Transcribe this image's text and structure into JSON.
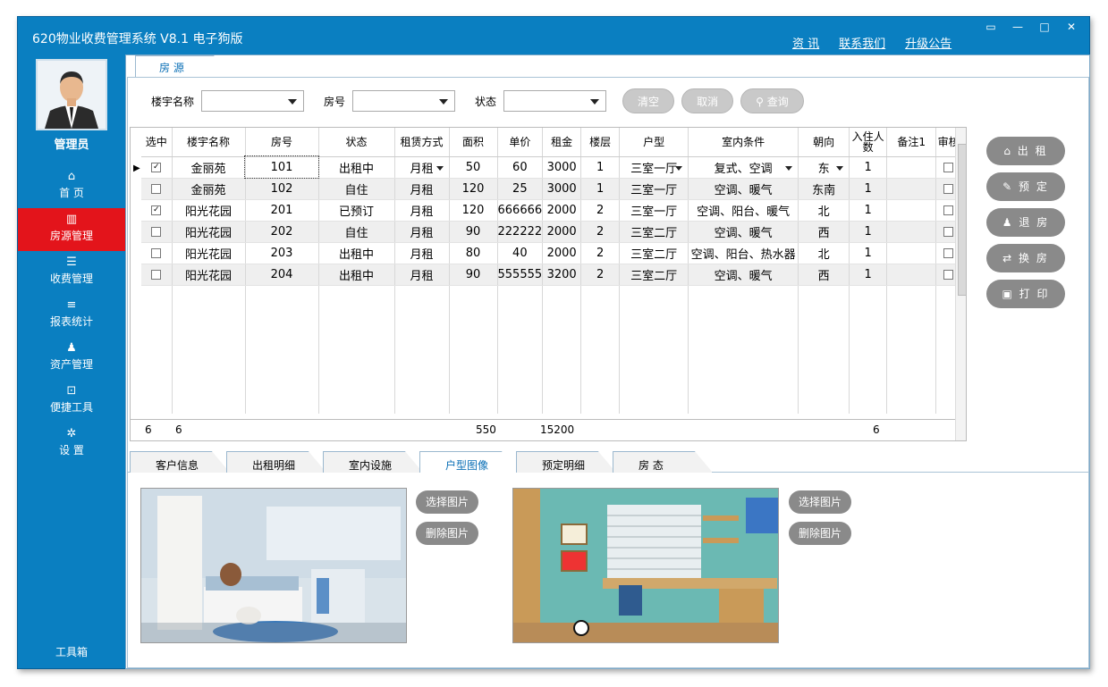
{
  "window": {
    "title": "620物业收费管理系统 V8.1  电子狗版",
    "links": [
      "资 讯",
      "联系我们",
      "升级公告"
    ],
    "controls": [
      "▭",
      "—",
      "□",
      "✕"
    ]
  },
  "sidebar": {
    "user": "管理员",
    "items": [
      {
        "icon": "home-icon",
        "label": "首 页",
        "glyph": "⌂"
      },
      {
        "icon": "building-icon",
        "label": "房源管理",
        "glyph": "▥",
        "active": true
      },
      {
        "icon": "list-icon",
        "label": "收费管理",
        "glyph": "☰"
      },
      {
        "icon": "report-icon",
        "label": "报表统计",
        "glyph": "≡"
      },
      {
        "icon": "asset-icon",
        "label": "资产管理",
        "glyph": "♟"
      },
      {
        "icon": "tool-icon",
        "label": "便捷工具",
        "glyph": "⊡"
      },
      {
        "icon": "gear-icon",
        "label": "设 置",
        "glyph": "✲"
      }
    ],
    "toolbox": "工具箱"
  },
  "top_tab": "房 源",
  "filters": {
    "building_label": "楼宇名称",
    "room_label": "房号",
    "status_label": "状态",
    "clear": "清空",
    "cancel": "取消",
    "query": "查询"
  },
  "grid": {
    "headers": [
      "选中",
      "楼宇名称",
      "房号",
      "状态",
      "租赁方式",
      "面积",
      "单价",
      "租金",
      "楼层",
      "户型",
      "室内条件",
      "朝向",
      "入住人数",
      "备注1",
      "审核"
    ],
    "rows": [
      {
        "checked": true,
        "building": "金丽苑",
        "room": "101",
        "status": "出租中",
        "lease": "月租",
        "area": "50",
        "price": "60",
        "rent": "3000",
        "floor": "1",
        "layout": "三室一厅",
        "cond": "复式、空调",
        "facing": "东",
        "people": "1",
        "note": "",
        "audit": false
      },
      {
        "checked": false,
        "building": "金丽苑",
        "room": "102",
        "status": "自住",
        "lease": "月租",
        "area": "120",
        "price": "25",
        "rent": "3000",
        "floor": "1",
        "layout": "三室一厅",
        "cond": "空调、暖气",
        "facing": "东南",
        "people": "1",
        "note": "",
        "audit": false
      },
      {
        "checked": true,
        "building": "阳光花园",
        "room": "201",
        "status": "已预订",
        "lease": "月租",
        "area": "120",
        "price": "666666",
        "rent": "2000",
        "floor": "2",
        "layout": "三室一厅",
        "cond": "空调、阳台、暖气",
        "facing": "北",
        "people": "1",
        "note": "",
        "audit": false
      },
      {
        "checked": false,
        "building": "阳光花园",
        "room": "202",
        "status": "自住",
        "lease": "月租",
        "area": "90",
        "price": "222222",
        "rent": "2000",
        "floor": "2",
        "layout": "三室二厅",
        "cond": "空调、暖气",
        "facing": "西",
        "people": "1",
        "note": "",
        "audit": false
      },
      {
        "checked": false,
        "building": "阳光花园",
        "room": "203",
        "status": "出租中",
        "lease": "月租",
        "area": "80",
        "price": "40",
        "rent": "2000",
        "floor": "2",
        "layout": "三室二厅",
        "cond": "空调、阳台、热水器",
        "facing": "北",
        "people": "1",
        "note": "",
        "audit": false
      },
      {
        "checked": false,
        "building": "阳光花园",
        "room": "204",
        "status": "出租中",
        "lease": "月租",
        "area": "90",
        "price": "555555",
        "rent": "3200",
        "floor": "2",
        "layout": "三室二厅",
        "cond": "空调、暖气",
        "facing": "西",
        "people": "1",
        "note": "",
        "audit": false
      }
    ],
    "summary": {
      "count": "6",
      "count2": "6",
      "area": "550",
      "rent": "15200",
      "people": "6"
    }
  },
  "actions": [
    "出 租",
    "预 定",
    "退 房",
    "换 房",
    "打 印"
  ],
  "bottom_tabs": [
    "客户信息",
    "出租明细",
    "室内设施",
    "户型图像",
    "预定明细",
    "房  态"
  ],
  "image_buttons": {
    "select": "选择图片",
    "delete": "删除图片"
  }
}
